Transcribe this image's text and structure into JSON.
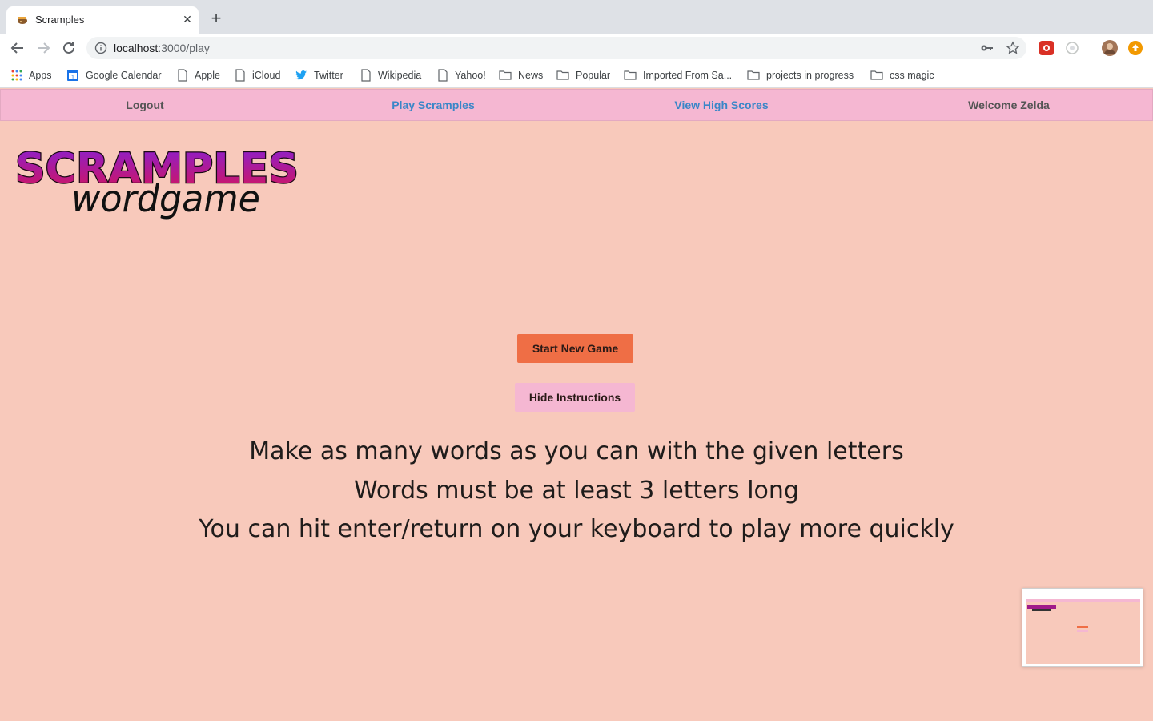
{
  "browser": {
    "tab_title": "Scramples",
    "url_host": "localhost",
    "url_path": ":3000/play",
    "bookmarks": [
      {
        "label": "Apps",
        "icon": "apps-grid-icon"
      },
      {
        "label": "Google Calendar",
        "icon": "calendar-icon"
      },
      {
        "label": "Apple",
        "icon": "page-icon"
      },
      {
        "label": "iCloud",
        "icon": "page-icon"
      },
      {
        "label": "Twitter",
        "icon": "twitter-bird-icon"
      },
      {
        "label": "Wikipedia",
        "icon": "page-icon"
      },
      {
        "label": "Yahoo!",
        "icon": "page-icon"
      },
      {
        "label": "News",
        "icon": "folder-icon"
      },
      {
        "label": "Popular",
        "icon": "folder-icon"
      },
      {
        "label": "Imported From Sa...",
        "icon": "folder-icon"
      },
      {
        "label": "projects in progress",
        "icon": "folder-icon"
      },
      {
        "label": "css magic",
        "icon": "folder-icon"
      }
    ]
  },
  "nav": {
    "logout": "Logout",
    "play": "Play Scramples",
    "high_scores": "View High Scores",
    "welcome": "Welcome Zelda"
  },
  "logo": {
    "title": "SCRAMPLES",
    "subtitle": "wordgame"
  },
  "buttons": {
    "start": "Start New Game",
    "hide": "Hide Instructions"
  },
  "instructions": [
    "Make as many words as you can with the given letters",
    "Words must be at least 3 letters long",
    "You can hit enter/return on your keyboard to play more quickly"
  ],
  "colors": {
    "page_background": "#f8c9bb",
    "nav_background": "#f5b7d2",
    "start_button": "#ef6e45",
    "link_blue": "#3a86c8"
  }
}
